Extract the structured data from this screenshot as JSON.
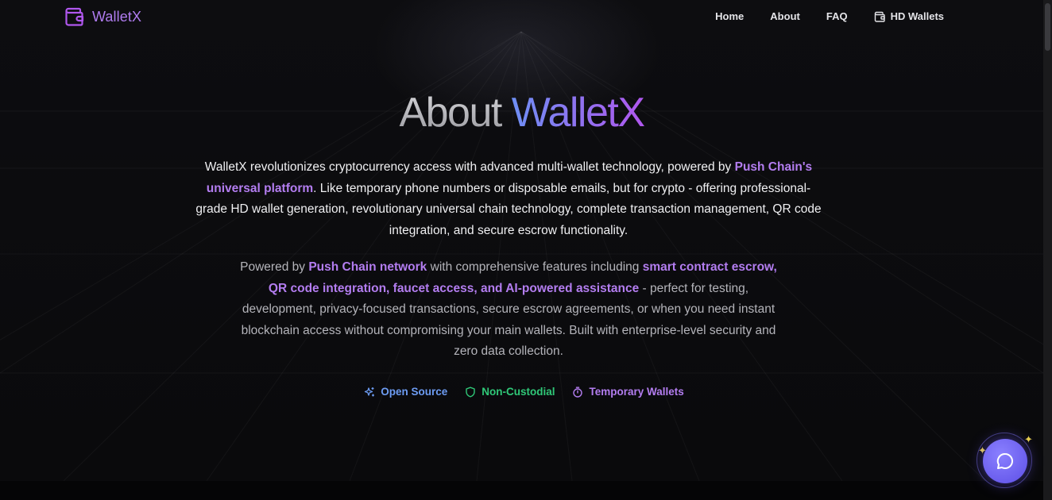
{
  "brand": {
    "name": "WalletX",
    "icon": "wallet-icon",
    "color": "#b07cf0"
  },
  "nav": {
    "links": [
      {
        "label": "Home"
      },
      {
        "label": "About"
      },
      {
        "label": "FAQ"
      },
      {
        "label": "HD Wallets",
        "icon": "wallet-icon"
      }
    ]
  },
  "hero": {
    "title_part1": "About ",
    "title_part2": "WalletX",
    "p1": {
      "t1": "WalletX revolutionizes cryptocurrency access with advanced multi-wallet technology, powered by ",
      "h1": "Push Chain's universal platform",
      "t2": ". Like temporary phone numbers or disposable emails, but for crypto - offering professional-grade HD wallet generation, revolutionary universal chain technology, complete transaction management, QR code integration, and secure escrow functionality."
    },
    "p2": {
      "t1": "Powered by ",
      "h1": "Push Chain network",
      "t2": " with comprehensive features including ",
      "h2": "smart contract escrow, QR code integration, faucet access, and AI-powered assistance",
      "t3": " - perfect for testing, development, privacy-focused transactions, secure escrow agreements, or when you need instant blockchain access without compromising your main wallets. Built with enterprise-level security and zero data collection."
    }
  },
  "badges": [
    {
      "label": "Open Source",
      "icon": "sparkles-icon",
      "color": "#6d9cf3"
    },
    {
      "label": "Non-Custodial",
      "icon": "shield-icon",
      "color": "#2fc878"
    },
    {
      "label": "Temporary Wallets",
      "icon": "timer-icon",
      "color": "#b37df0"
    }
  ],
  "chat": {
    "icon": "chat-bubble-icon",
    "accent": "#6e5cf0"
  }
}
